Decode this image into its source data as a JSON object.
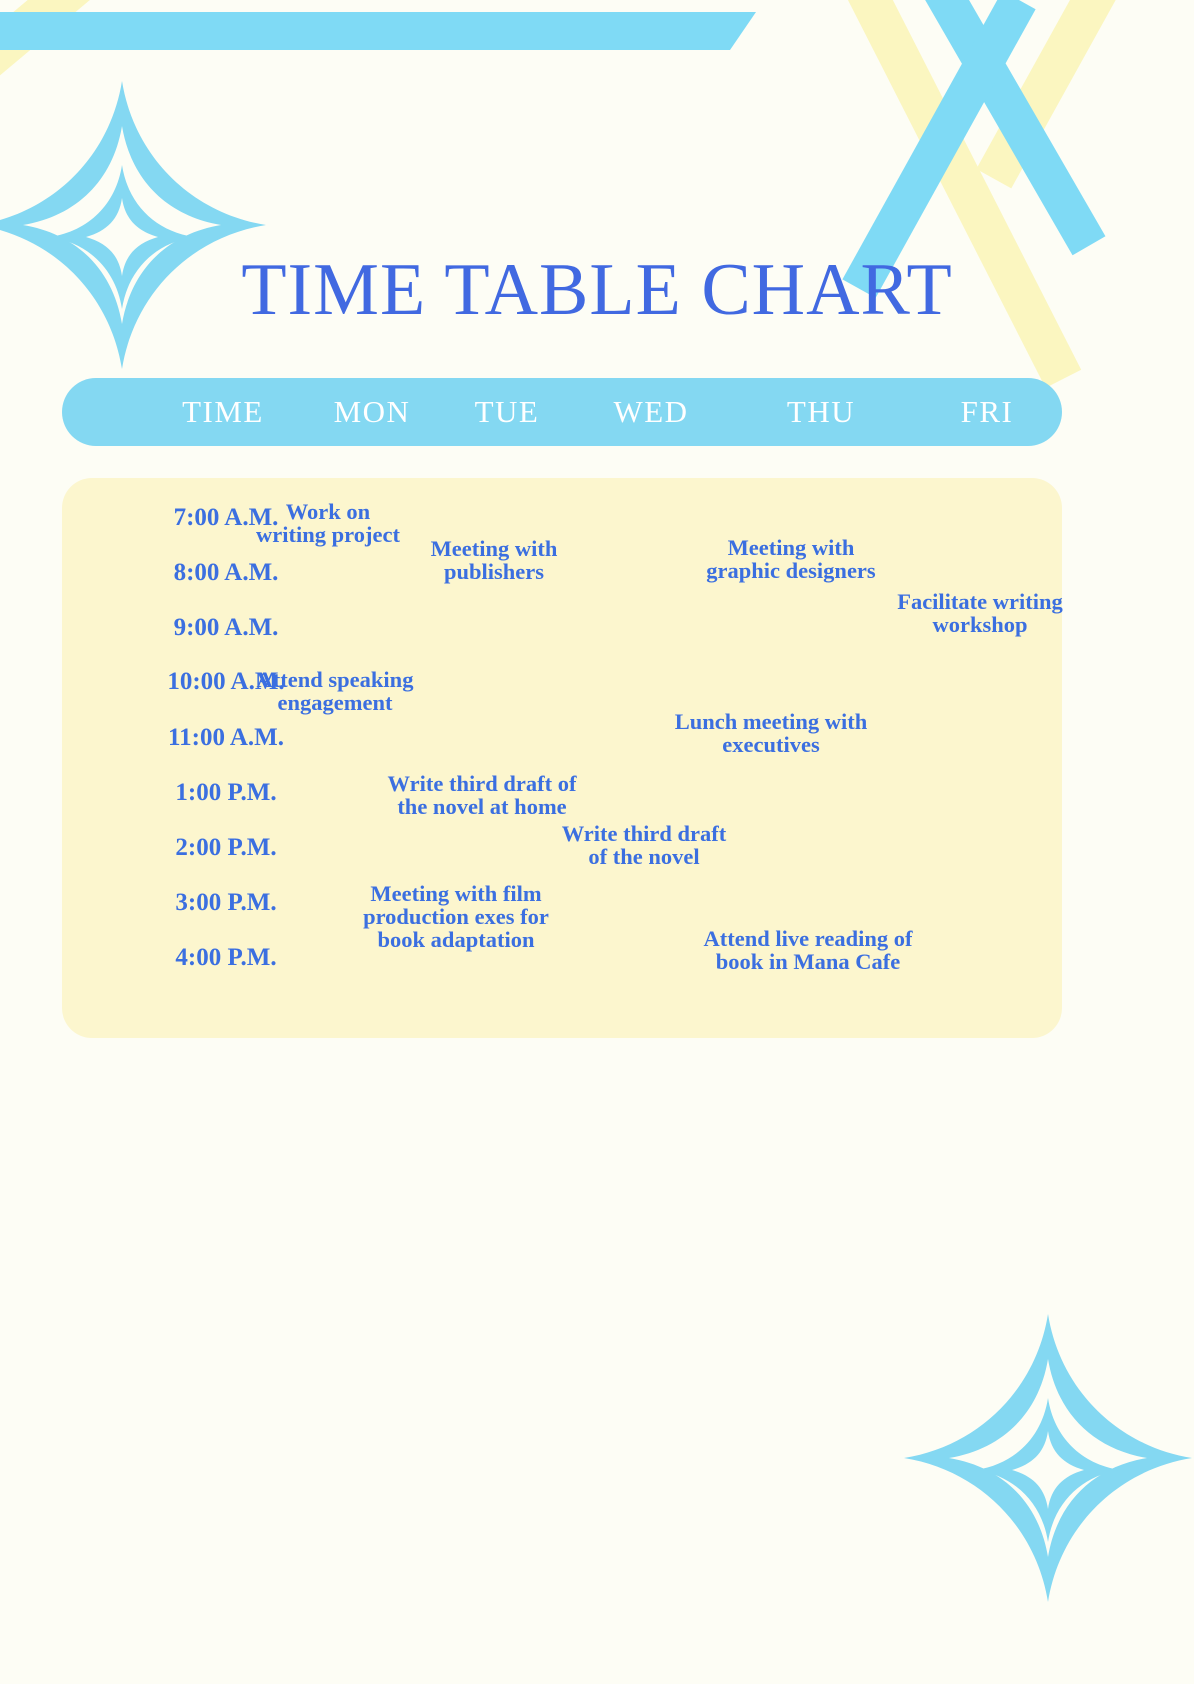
{
  "page": {
    "background_color": "#FDFDF5",
    "accent_blue": "#4169E1",
    "header_blue": "#84D8F2",
    "panel_yellow": "#FCF6CE",
    "ribbon_blue": "#7FDAF5",
    "ribbon_yellow": "#FBF6C0"
  },
  "title": "TIME TABLE CHART",
  "header": {
    "columns": [
      {
        "label": "TIME"
      },
      {
        "label": "MON"
      },
      {
        "label": "TUE"
      },
      {
        "label": "WED"
      },
      {
        "label": "THU"
      },
      {
        "label": "FRI"
      }
    ]
  },
  "times": [
    "7:00 A.M.",
    "8:00 A.M.",
    "9:00 A.M.",
    "10:00 A.M.",
    "11:00 A.M.",
    "1:00 P.M.",
    "2:00 P.M.",
    "3:00 P.M.",
    "4:00 P.M."
  ],
  "entries": [
    {
      "day": "MON",
      "text": "Work on writing project"
    },
    {
      "day": "TUE",
      "text": "Meeting with publishers"
    },
    {
      "day": "THU",
      "text": "Meeting with graphic designers"
    },
    {
      "day": "FRI",
      "text": "Facilitate writing workshop"
    },
    {
      "day": "MON",
      "text": "Attend speaking engagement"
    },
    {
      "day": "THU",
      "text": "Lunch meeting with executives"
    },
    {
      "day": "TUE",
      "text": "Write third draft of the novel at home"
    },
    {
      "day": "WED",
      "text": "Write third draft of the novel"
    },
    {
      "day": "TUE",
      "text": "Meeting with film production exes for book adaptation"
    },
    {
      "day": "THU",
      "text": "Attend live reading of book in Mana Cafe"
    }
  ],
  "decorations": [
    {
      "name": "sparkle-top-left"
    },
    {
      "name": "sparkle-bottom-right"
    }
  ]
}
